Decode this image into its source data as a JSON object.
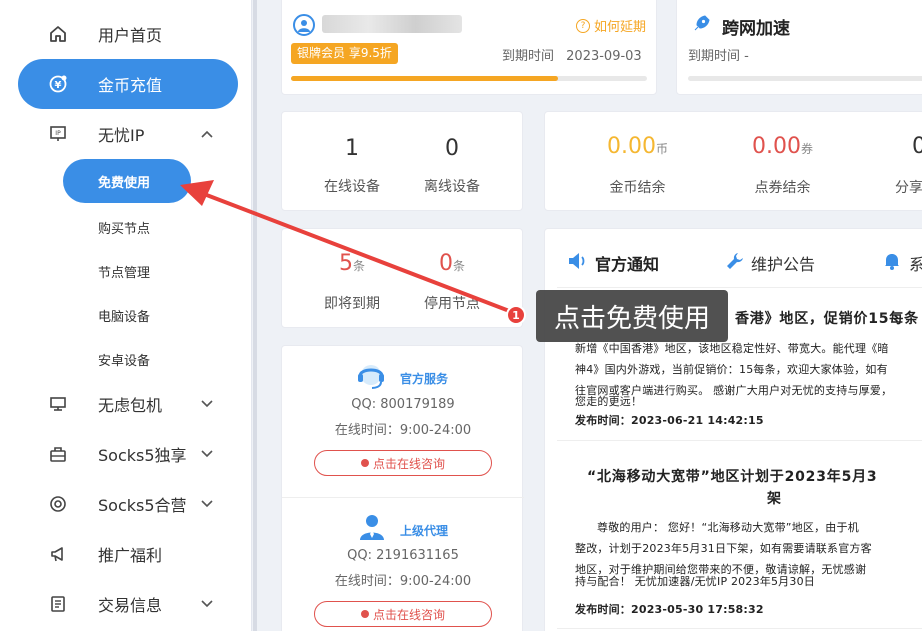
{
  "sidebar": {
    "home": "用户首页",
    "recharge": "金币充值",
    "wuyou_ip": "无忧IP",
    "sub": {
      "free": "免费使用",
      "buy": "购买节点",
      "manage": "节点管理",
      "pc": "电脑设备",
      "android": "安卓设备"
    },
    "package": "无虑包机",
    "socks5_exclusive": "Socks5独享",
    "socks5_shared": "Socks5合营",
    "promo": "推广福利",
    "trade": "交易信息"
  },
  "membership": {
    "extend": "如何延期",
    "badge": "银牌会员 享9.5折",
    "expire_label": "到期时间",
    "expire_date": "2023-09-03",
    "progress": 0.75
  },
  "cross_border": {
    "title": "跨网加速",
    "expire": "到期时间  -"
  },
  "devices": {
    "online_count": "1",
    "online_label": "在线设备",
    "offline_count": "0",
    "offline_label": "离线设备"
  },
  "balance": {
    "gold_value": "0.00",
    "gold_unit": "币",
    "gold_label": "金币结余",
    "coupon_value": "0.00",
    "coupon_unit": "券",
    "coupon_label": "点券结余",
    "share_value": "0",
    "share_label": "分享"
  },
  "nodes": {
    "expiring_count": "5",
    "expiring_unit": "条",
    "expiring_label": "即将到期",
    "stopped_count": "0",
    "stopped_unit": "条",
    "stopped_label": "停用节点"
  },
  "service": {
    "official_title": "官方服务",
    "official_qq": "QQ:  800179189",
    "official_time": "在线时间：9:00-24:00",
    "consult": "点击在线咨询",
    "agent_title": "上级代理",
    "agent_qq": "QQ:  2191631165",
    "agent_time": "在线时间：9:00-24:00"
  },
  "notices": {
    "tab_official": "官方通知",
    "tab_maintenance": "维护公告",
    "tab_system": "系",
    "n1_title": "香港》地区，促销价15每条",
    "n1_lines": [
      "新增《中国香港》地区，该地区稳定性好、带宽大。能代理《暗",
      "神4》国内外游戏，当前促销价：15每条，欢迎大家体验，如有",
      "往官网或客户端进行购买。 感谢广大用户对无忧的支持与厚爱，",
      "您走的更远！"
    ],
    "n1_time": "发布时间：2023-06-21 14:42:15",
    "n2_title_1": "“北海移动大宽带”地区计划于2023年5月3",
    "n2_title_2": "架",
    "n2_lines": [
      "尊敬的用户：  您好！“北海移动大宽带”地区，由于机",
      "整改，计划于2023年5月31日下架，如有需要请联系官方客",
      "地区，对于维护期间给您带来的不便，敬请谅解，无忧感谢",
      "持与配合！  无忧加速器/无忧IP 2023年5月30日"
    ],
    "n2_time": "发布时间：2023-05-30 17:58:32"
  },
  "tooltip": {
    "step": "1",
    "text": "点击免费使用"
  },
  "colors": {
    "primary": "#3a8ee6",
    "orange": "#f5a623",
    "gold_text": "#f5b731",
    "red_text": "#e0524d",
    "annotation_red": "#e8413c"
  }
}
